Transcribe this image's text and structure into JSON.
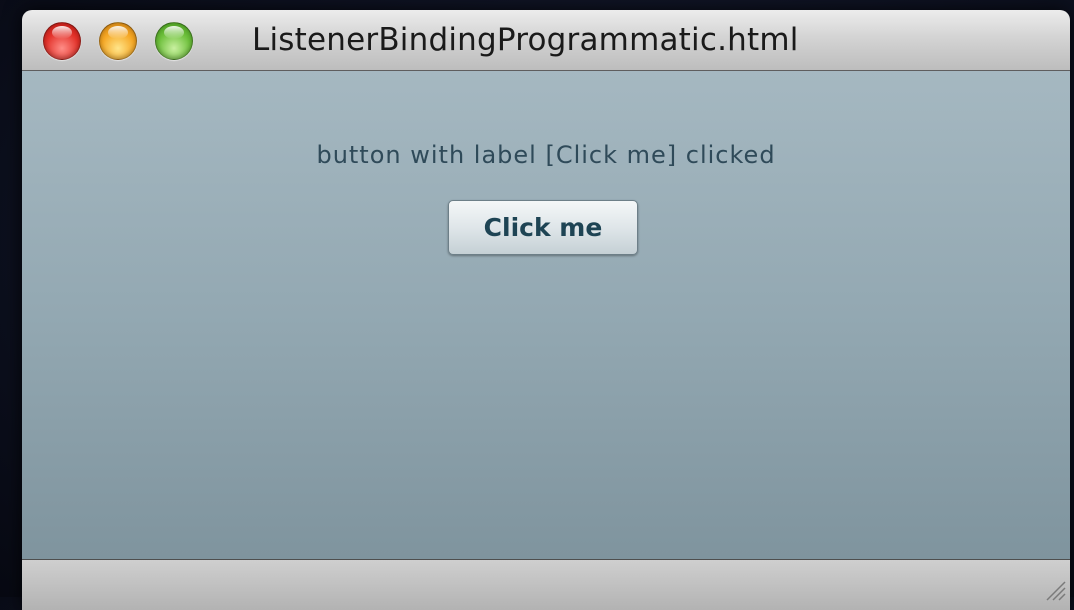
{
  "window": {
    "title": "ListenerBindingProgrammatic.html",
    "controls": {
      "close": "close-button",
      "minimize": "minimize-button",
      "zoom": "zoom-button"
    }
  },
  "content": {
    "message": "button with label [Click me] clicked",
    "button_label": "Click me"
  },
  "colors": {
    "content_top": "#a5b8c1",
    "content_bottom": "#7f949e",
    "message_text": "#2f4a59",
    "button_text": "#1e4454"
  }
}
